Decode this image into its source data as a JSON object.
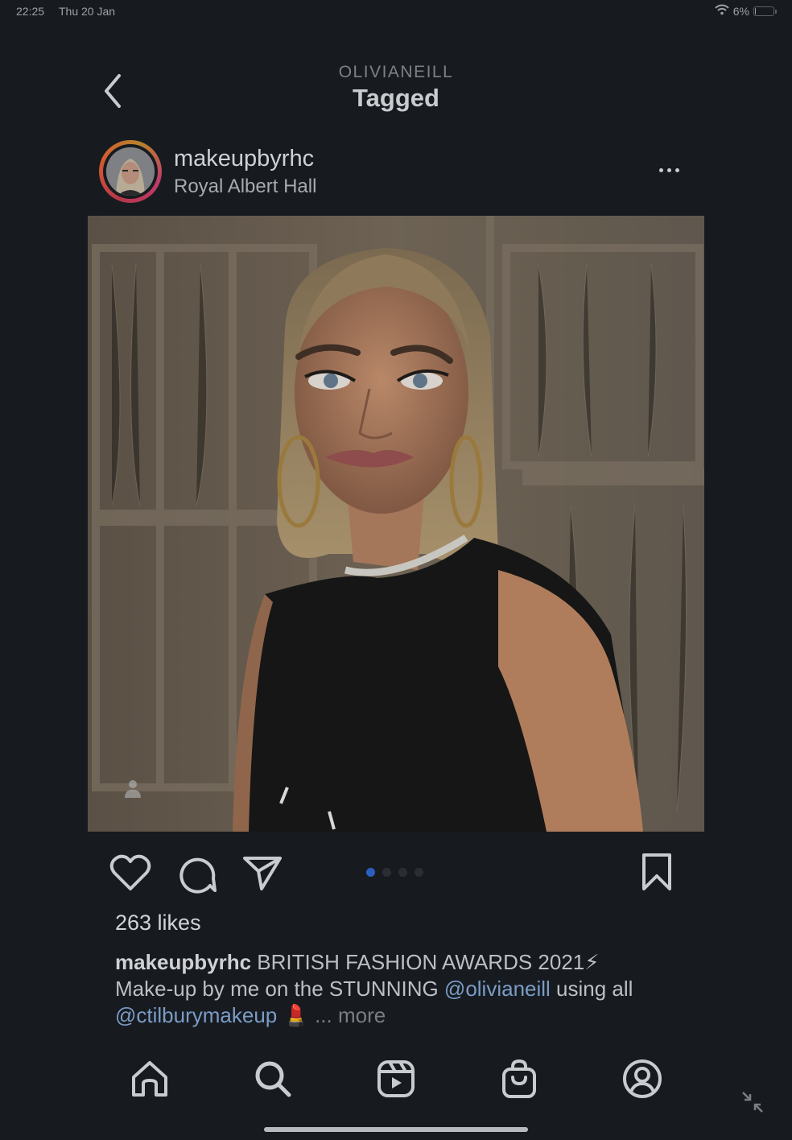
{
  "status_bar": {
    "time": "22:25",
    "date": "Thu 20 Jan",
    "battery": "6%",
    "battery_level": 0.06
  },
  "header": {
    "username": "OLIVIANEILL",
    "title": "Tagged"
  },
  "post": {
    "username": "makeupbyrhc",
    "location": "Royal Albert Hall",
    "likes": "263 likes",
    "carousel": {
      "count": 4,
      "active_index": 0
    },
    "caption": {
      "author": "makeupbyrhc",
      "text_1": " BRITISH FASHION AWARDS 2021",
      "emoji_1": "⚡",
      "text_2": " Make-up by me on the STUNNING ",
      "mention_1": "@olivianeill",
      "text_3": " using all ",
      "mention_2": "@ctilburymakeup",
      "emoji_2": "💄",
      "ellipsis": " ... ",
      "more": "more"
    }
  },
  "icons": {
    "back": "chevron-left-icon",
    "more": "more-horizontal-icon",
    "like": "heart-icon",
    "comment": "comment-icon",
    "share": "paper-plane-icon",
    "save": "bookmark-icon",
    "home": "home-icon",
    "search": "search-icon",
    "reels": "reels-icon",
    "shop": "shopping-bag-icon",
    "profile": "profile-icon",
    "collapse": "collapse-arrows-icon",
    "tagged_user": "person-icon"
  },
  "colors": {
    "background": "#171b20",
    "mention": "#7b9cc6",
    "active_dot": "#2a5fbf",
    "text": "#d7d9dc"
  }
}
